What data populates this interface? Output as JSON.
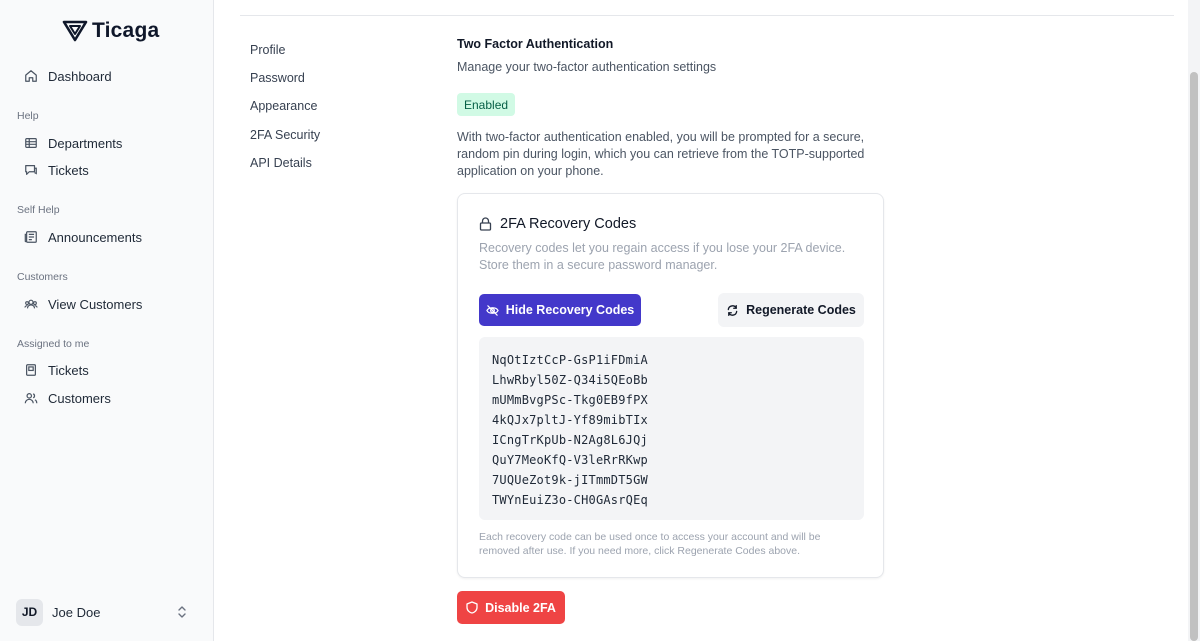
{
  "app": {
    "name": "Ticaga"
  },
  "sidebar": {
    "dashboard": "Dashboard",
    "groups": [
      {
        "label": "Help",
        "items": [
          "Departments",
          "Tickets"
        ]
      },
      {
        "label": "Self Help",
        "items": [
          "Announcements"
        ]
      },
      {
        "label": "Customers",
        "items": [
          "View Customers"
        ]
      },
      {
        "label": "Assigned to me",
        "items": [
          "Tickets",
          "Customers"
        ]
      }
    ],
    "user": {
      "initials": "JD",
      "name": "Joe Doe"
    }
  },
  "settings_nav": [
    "Profile",
    "Password",
    "Appearance",
    "2FA Security",
    "API Details"
  ],
  "two_factor": {
    "title": "Two Factor Authentication",
    "description": "Manage your two-factor authentication settings",
    "status": "Enabled",
    "status_color": "#d1fae5",
    "info": "With two-factor authentication enabled, you will be prompted for a secure, random pin during login, which you can retrieve from the TOTP-supported application on your phone."
  },
  "recovery": {
    "title": "2FA Recovery Codes",
    "description": "Recovery codes let you regain access if you lose your 2FA device. Store them in a secure password manager.",
    "hide_button": "Hide Recovery Codes",
    "regenerate_button": "Regenerate Codes",
    "codes": [
      "NqOtIztCcP-GsP1iFDmiA",
      "LhwRbyl50Z-Q34i5QEoBb",
      "mUMmBvgPSc-Tkg0EB9fPX",
      "4kQJx7pltJ-Yf89mibTIx",
      "ICngTrKpUb-N2Ag8L6JQj",
      "QuY7MeoKfQ-V3leRrRKwp",
      "7UQUeZot9k-jITmmDT5GW",
      "TWYnEuiZ3o-CH0GAsrQEq"
    ],
    "note": "Each recovery code can be used once to access your account and will be removed after use. If you need more, click Regenerate Codes above.",
    "accent_color": "#4338ca"
  },
  "disable_button": "Disable 2FA",
  "danger_color": "#ef4444"
}
